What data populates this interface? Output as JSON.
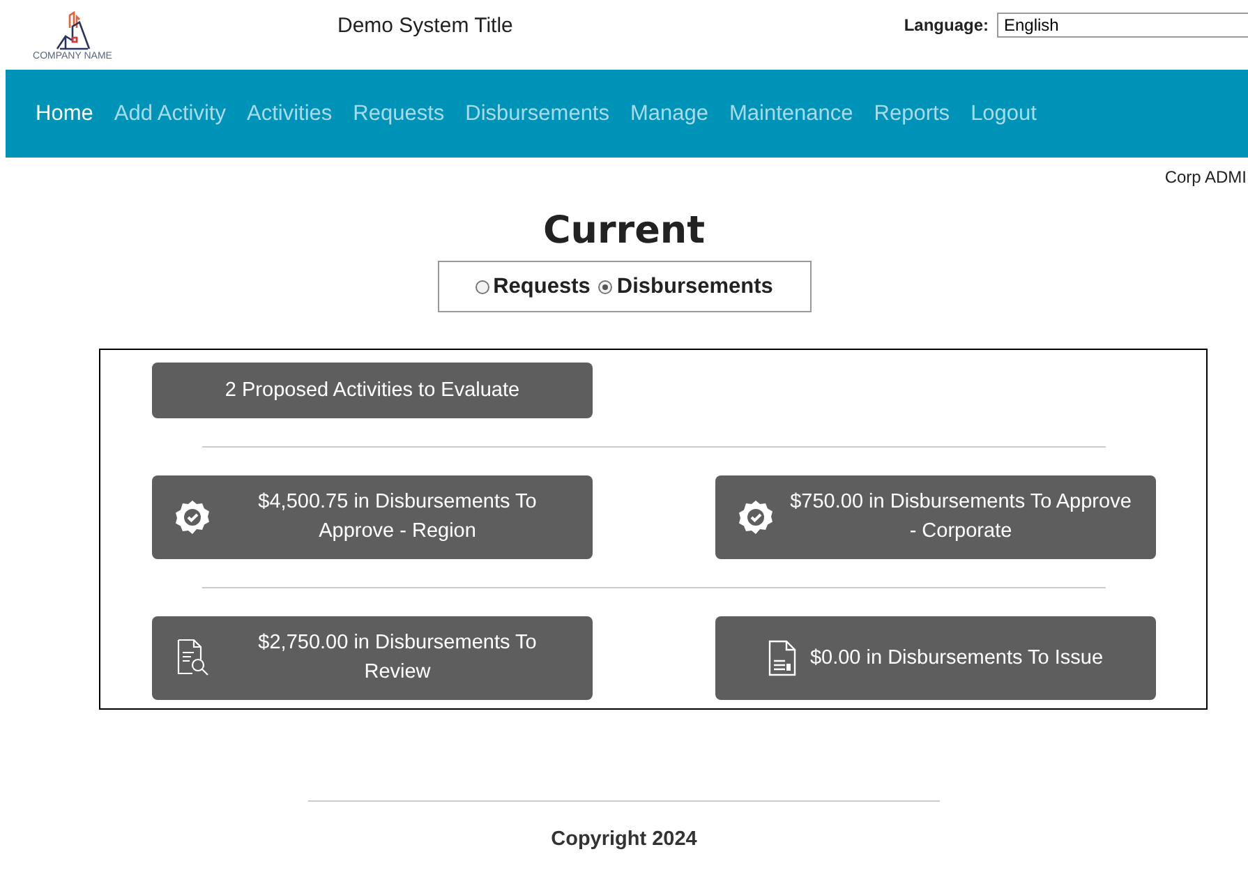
{
  "header": {
    "logo_text": "COMPANY NAME",
    "title": "Demo System Title",
    "language_label": "Language:",
    "language_value": "English"
  },
  "nav": [
    {
      "label": "Home",
      "selected": true
    },
    {
      "label": "Add Activity",
      "selected": false
    },
    {
      "label": "Activities",
      "selected": false
    },
    {
      "label": "Requests",
      "selected": false
    },
    {
      "label": "Disbursements",
      "selected": false
    },
    {
      "label": "Manage",
      "selected": false
    },
    {
      "label": "Maintenance",
      "selected": false
    },
    {
      "label": "Reports",
      "selected": false
    },
    {
      "label": "Logout",
      "selected": false
    }
  ],
  "user": "Corp ADMI",
  "heading": "Current",
  "view_options": [
    {
      "label": "Requests",
      "selected": false
    },
    {
      "label": "Disbursements",
      "selected": true
    }
  ],
  "panel_rows": [
    [
      {
        "kind": "plain",
        "label": "2 Proposed Activities to Evaluate"
      }
    ],
    [
      {
        "kind": "approve",
        "label": "$4,500.75 in Disbursements To Approve - Region"
      },
      {
        "kind": "approve",
        "label": "$750.00 in Disbursements To Approve - Corporate"
      }
    ],
    [
      {
        "kind": "review",
        "label": "$2,750.00 in Disbursements To Review"
      },
      {
        "kind": "issue",
        "label": "$0.00 in Disbursements To Issue"
      }
    ]
  ],
  "footer": "Copyright 2024"
}
